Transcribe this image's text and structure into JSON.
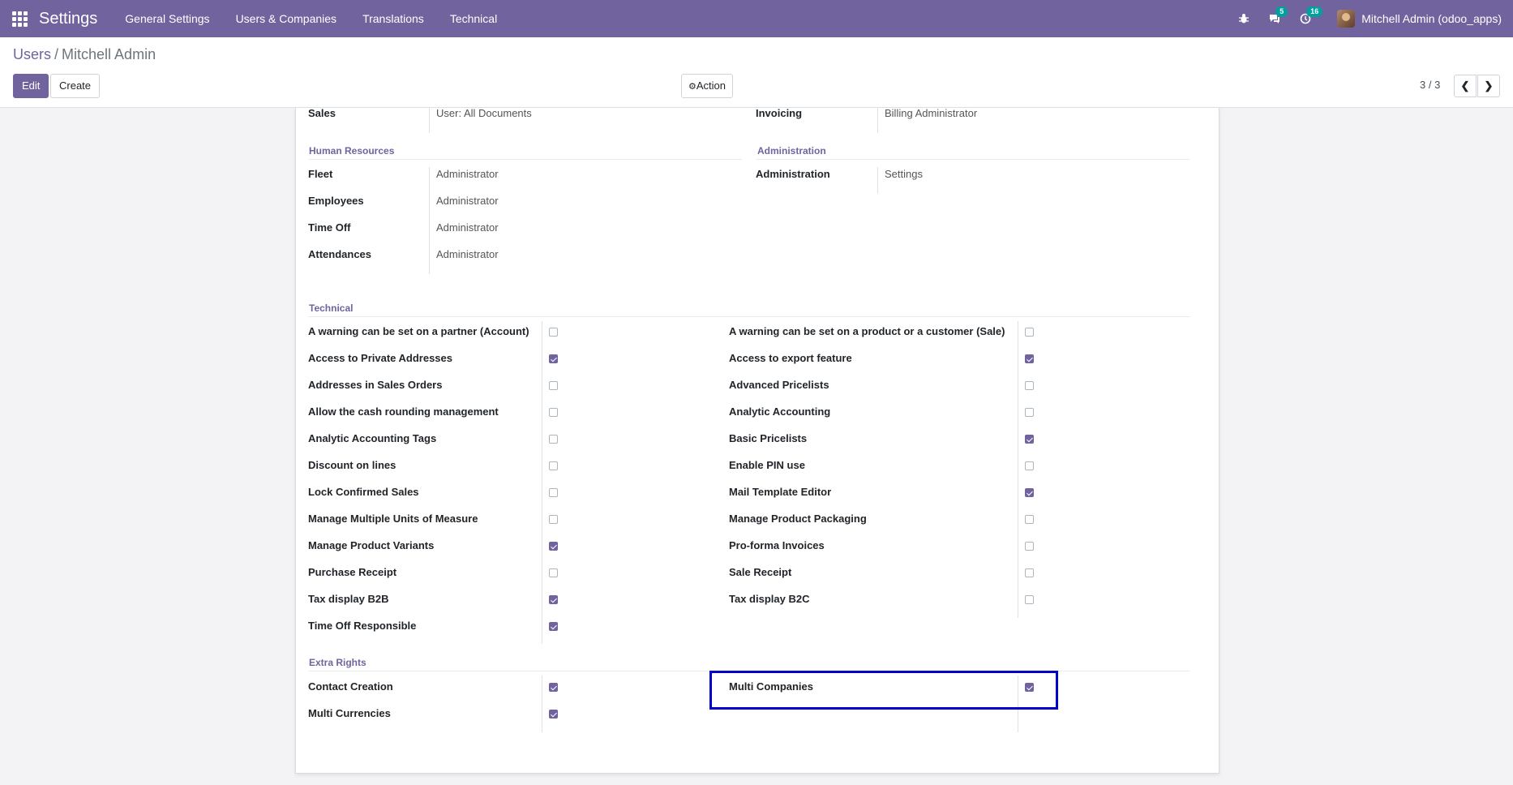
{
  "navbar": {
    "brand": "Settings",
    "menu": [
      "General Settings",
      "Users & Companies",
      "Translations",
      "Technical"
    ],
    "messages_badge": "5",
    "activities_badge": "16",
    "user_name": "Mitchell Admin (odoo_apps)"
  },
  "control_panel": {
    "breadcrumb_parent": "Users",
    "breadcrumb_separator": "/",
    "breadcrumb_current": "Mitchell Admin",
    "edit_label": "Edit",
    "create_label": "Create",
    "action_label": "Action",
    "pager_value": "3 / 3"
  },
  "top_rows": [
    {
      "label": "Sales",
      "value": "User: All Documents"
    },
    {
      "label": "Invoicing",
      "value": "Billing Administrator"
    }
  ],
  "human_resources": {
    "title": "Human Resources",
    "rows": [
      {
        "label": "Fleet",
        "value": "Administrator"
      },
      {
        "label": "Employees",
        "value": "Administrator"
      },
      {
        "label": "Time Off",
        "value": "Administrator"
      },
      {
        "label": "Attendances",
        "value": "Administrator"
      }
    ]
  },
  "administration": {
    "title": "Administration",
    "rows": [
      {
        "label": "Administration",
        "value": "Settings"
      }
    ]
  },
  "technical": {
    "title": "Technical",
    "left": [
      {
        "label": "A warning can be set on a partner (Account)",
        "checked": false
      },
      {
        "label": "Access to Private Addresses",
        "checked": true
      },
      {
        "label": "Addresses in Sales Orders",
        "checked": false
      },
      {
        "label": "Allow the cash rounding management",
        "checked": false
      },
      {
        "label": "Analytic Accounting Tags",
        "checked": false
      },
      {
        "label": "Discount on lines",
        "checked": false
      },
      {
        "label": "Lock Confirmed Sales",
        "checked": false
      },
      {
        "label": "Manage Multiple Units of Measure",
        "checked": false
      },
      {
        "label": "Manage Product Variants",
        "checked": true
      },
      {
        "label": "Purchase Receipt",
        "checked": false
      },
      {
        "label": "Tax display B2B",
        "checked": true
      },
      {
        "label": "Time Off Responsible",
        "checked": true
      }
    ],
    "right": [
      {
        "label": "A warning can be set on a product or a customer (Sale)",
        "checked": false
      },
      {
        "label": "Access to export feature",
        "checked": true
      },
      {
        "label": "Advanced Pricelists",
        "checked": false
      },
      {
        "label": "Analytic Accounting",
        "checked": false
      },
      {
        "label": "Basic Pricelists",
        "checked": true
      },
      {
        "label": "Enable PIN use",
        "checked": false
      },
      {
        "label": "Mail Template Editor",
        "checked": true
      },
      {
        "label": "Manage Product Packaging",
        "checked": false
      },
      {
        "label": "Pro-forma Invoices",
        "checked": false
      },
      {
        "label": "Sale Receipt",
        "checked": false
      },
      {
        "label": "Tax display B2C",
        "checked": false
      }
    ]
  },
  "extra_rights": {
    "title": "Extra Rights",
    "left": [
      {
        "label": "Contact Creation",
        "checked": true
      },
      {
        "label": "Multi Currencies",
        "checked": true
      }
    ],
    "right": [
      {
        "label": "Multi Companies",
        "checked": true
      }
    ]
  },
  "colors": {
    "brand": "#71639e",
    "highlight": "#0000cc"
  }
}
